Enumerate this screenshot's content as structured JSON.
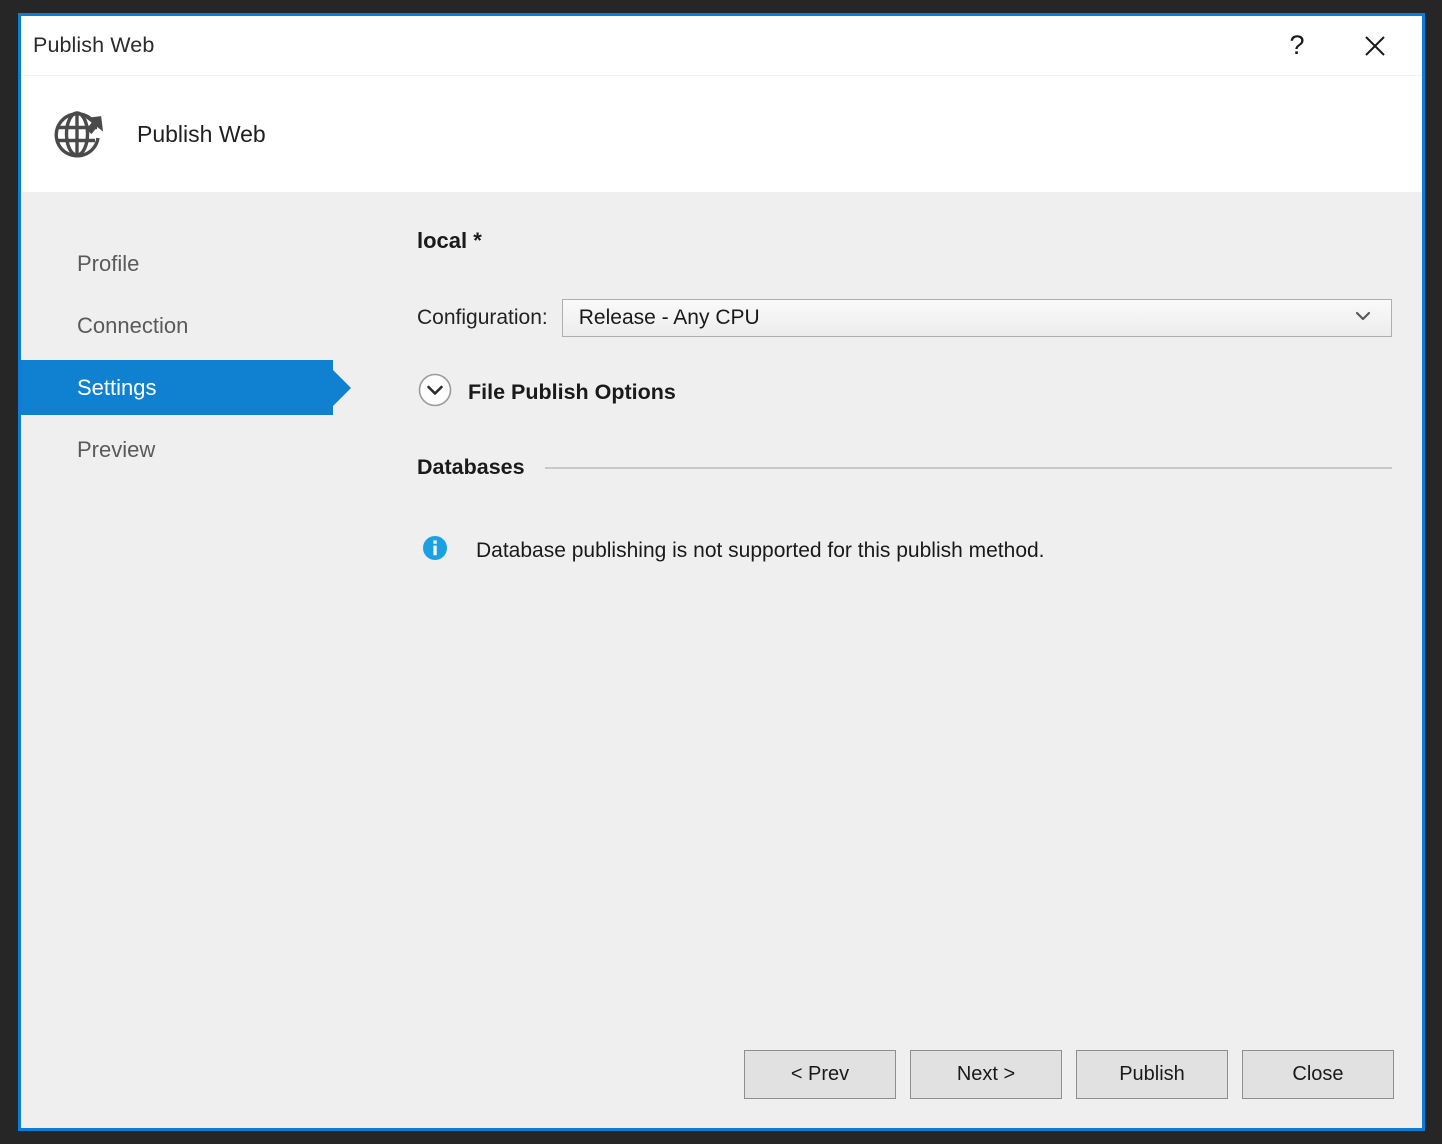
{
  "window": {
    "title": "Publish Web",
    "help_label": "?",
    "close_label": "Close",
    "border_color": "#0C7CD5",
    "desktop_color": "#262626"
  },
  "header": {
    "title": "Publish Web",
    "icon": "publish-globe-icon"
  },
  "sidebar": {
    "items": [
      {
        "label": "Profile",
        "selected": false
      },
      {
        "label": "Connection",
        "selected": false
      },
      {
        "label": "Settings",
        "selected": true
      },
      {
        "label": "Preview",
        "selected": false
      }
    ],
    "selected_color": "#1081D0"
  },
  "main": {
    "profile_name": "local *",
    "configuration": {
      "label": "Configuration:",
      "value": "Release - Any CPU",
      "chevron_icon": "chevron-down-icon"
    },
    "file_publish_options": {
      "label": "File Publish Options",
      "expander_icon": "chevron-down-circle-icon",
      "expanded": false
    },
    "databases": {
      "heading": "Databases",
      "info_icon": "info-icon",
      "info_color": "#1BA1E2",
      "message": "Database publishing is not supported for this publish method."
    }
  },
  "footer": {
    "buttons": [
      {
        "label": "< Prev",
        "name": "prev-button"
      },
      {
        "label": "Next >",
        "name": "next-button"
      },
      {
        "label": "Publish",
        "name": "publish-button"
      },
      {
        "label": "Close",
        "name": "close-dialog-button"
      }
    ]
  }
}
